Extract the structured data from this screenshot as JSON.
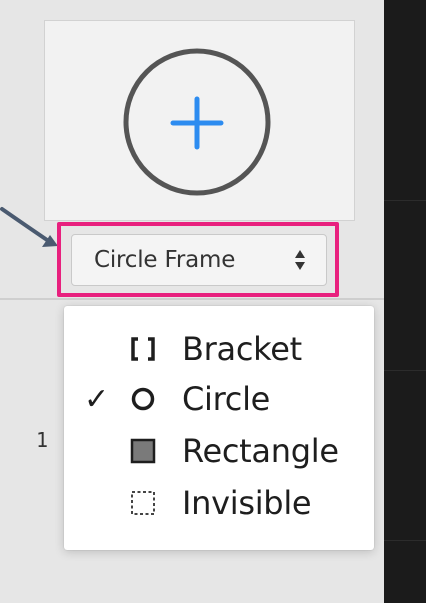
{
  "frame_select": {
    "selected_label": "Circle Frame"
  },
  "frame_menu": {
    "items": [
      {
        "label": "Bracket",
        "checked": false,
        "icon": "bracket-icon"
      },
      {
        "label": "Circle",
        "checked": true,
        "icon": "circle-outline-icon"
      },
      {
        "label": "Rectangle",
        "checked": false,
        "icon": "filled-square-icon"
      },
      {
        "label": "Invisible",
        "checked": false,
        "icon": "dashed-square-icon"
      }
    ],
    "check_mark": "✓"
  },
  "row_label": "1",
  "colors": {
    "highlight": "#e8207e",
    "plus": "#2d8cf0",
    "circle_stroke": "#555555",
    "pointer_arrow": "#4a5a70"
  }
}
